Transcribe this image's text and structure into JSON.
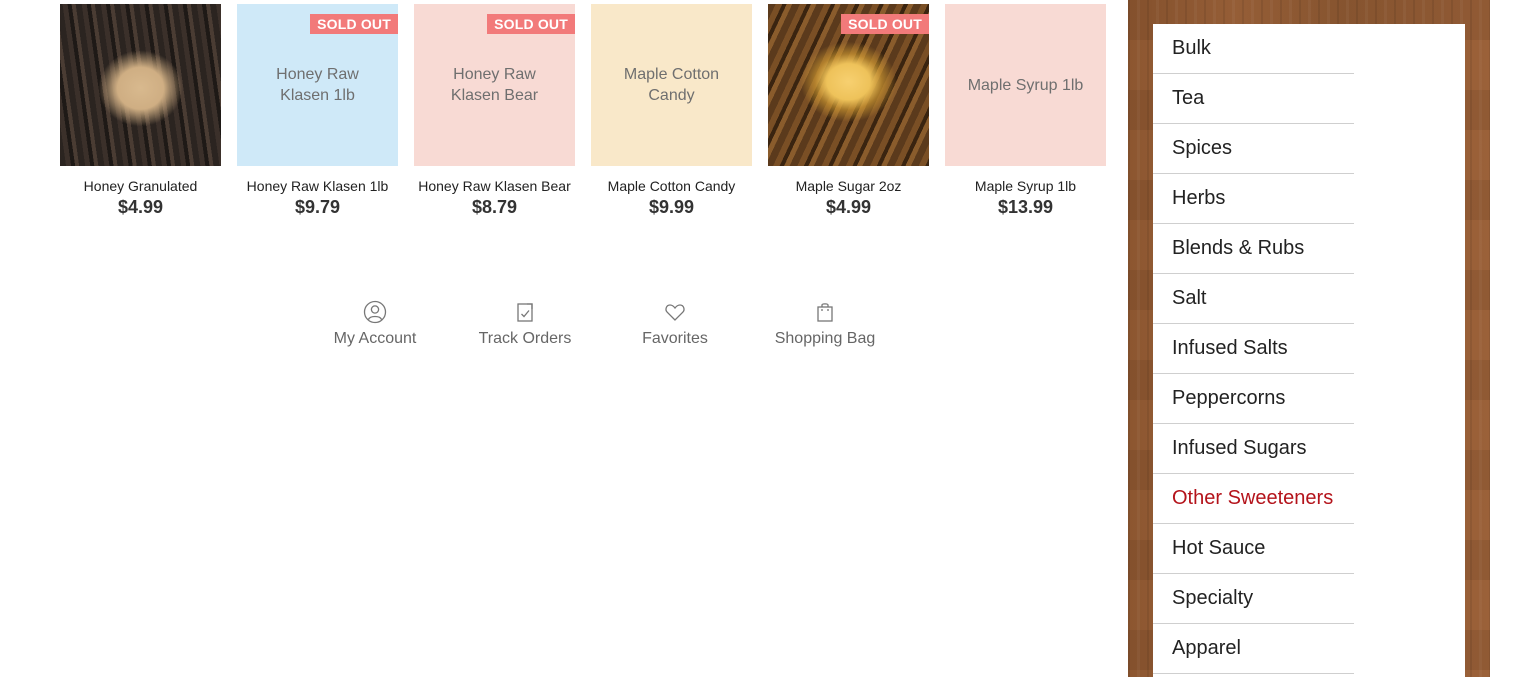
{
  "products": [
    {
      "name": "Honey Granulated",
      "price": "$4.99",
      "thumb_text": "",
      "sold_out": false,
      "image": "photo-granulated"
    },
    {
      "name": "Honey Raw Klasen 1lb",
      "price": "$9.79",
      "thumb_text": "Honey Raw Klasen 1lb",
      "sold_out": true,
      "bg": "#cfe9f8"
    },
    {
      "name": "Honey Raw Klasen Bear",
      "price": "$8.79",
      "thumb_text": "Honey Raw Klasen Bear",
      "sold_out": true,
      "bg": "#f8dad4"
    },
    {
      "name": "Maple Cotton Candy",
      "price": "$9.99",
      "thumb_text": "Maple Cotton Candy",
      "sold_out": false,
      "bg": "#f9e8c9"
    },
    {
      "name": "Maple Sugar 2oz",
      "price": "$4.99",
      "thumb_text": "",
      "sold_out": true,
      "image": "photo-sugar"
    },
    {
      "name": "Maple Syrup 1lb",
      "price": "$13.99",
      "thumb_text": "Maple Syrup 1lb",
      "sold_out": false,
      "bg": "#f8dad4"
    }
  ],
  "sold_out_label": "SOLD OUT",
  "footer_nav": [
    {
      "label": "My Account",
      "icon": "account-icon"
    },
    {
      "label": "Track Orders",
      "icon": "track-orders-icon"
    },
    {
      "label": "Favorites",
      "icon": "heart-icon"
    },
    {
      "label": "Shopping Bag",
      "icon": "shopping-bag-icon"
    }
  ],
  "categories": [
    {
      "label": "Bulk"
    },
    {
      "label": "Tea"
    },
    {
      "label": "Spices"
    },
    {
      "label": "Herbs"
    },
    {
      "label": "Blends & Rubs"
    },
    {
      "label": "Salt"
    },
    {
      "label": "Infused Salts"
    },
    {
      "label": "Peppercorns"
    },
    {
      "label": "Infused Sugars"
    },
    {
      "label": "Other Sweeteners",
      "active": true
    },
    {
      "label": "Hot Sauce"
    },
    {
      "label": "Specialty"
    },
    {
      "label": "Apparel"
    }
  ],
  "colors": {
    "sold_out_badge": "#f27a7a",
    "active_category": "#b4131b"
  }
}
